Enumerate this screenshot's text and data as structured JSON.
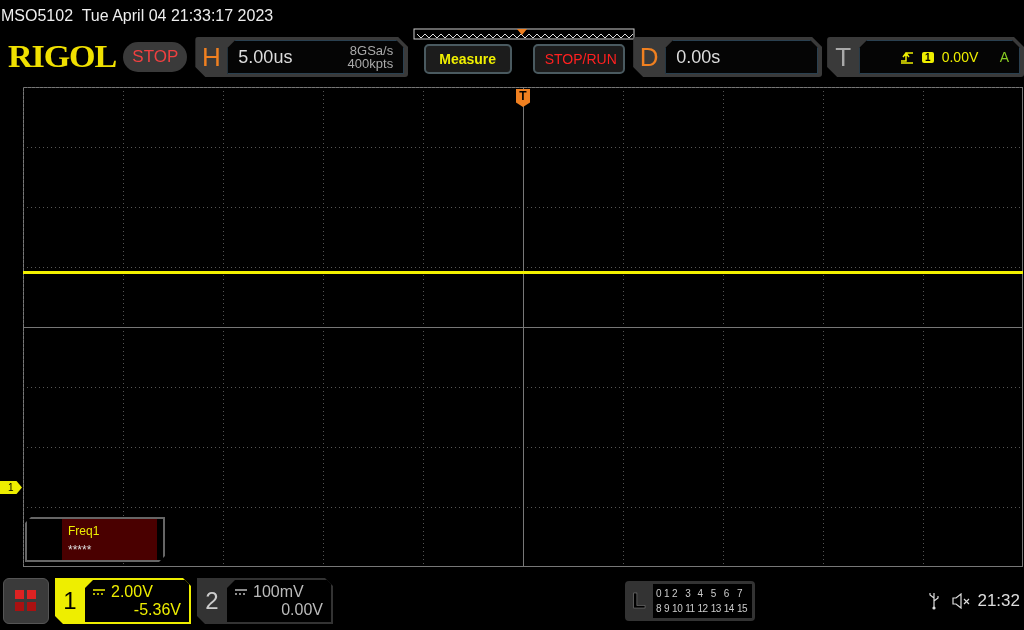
{
  "model": "MSO5102",
  "datetime": "Tue April 04 21:33:17 2023",
  "logo": "RIGOL",
  "run_state": "STOP",
  "horizontal": {
    "label": "H",
    "timebase": "5.00us",
    "sample_rate": "8GSa/s",
    "memory_depth": "400kpts"
  },
  "buttons": [
    "Measure",
    "STOP/RUN"
  ],
  "delay": {
    "label": "D",
    "value": "0.00s"
  },
  "trigger": {
    "label": "T",
    "source": "1",
    "level": "0.00V",
    "mode": "A"
  },
  "trigger_marker": "T",
  "channel_marker": "1",
  "measurement": {
    "name": "Freq1",
    "value": "*****"
  },
  "channels": [
    {
      "number": "1",
      "scale": "2.00V",
      "offset": "-5.36V",
      "enabled": true
    },
    {
      "number": "2",
      "scale": "100mV",
      "offset": "0.00V",
      "enabled": false
    }
  ],
  "logic": {
    "label": "L",
    "channels": [
      "0",
      "1",
      "2",
      "3",
      "4",
      "5",
      "6",
      "7",
      "8",
      "9",
      "10",
      "11",
      "12",
      "13",
      "14",
      "15"
    ]
  },
  "clock": "21:32"
}
